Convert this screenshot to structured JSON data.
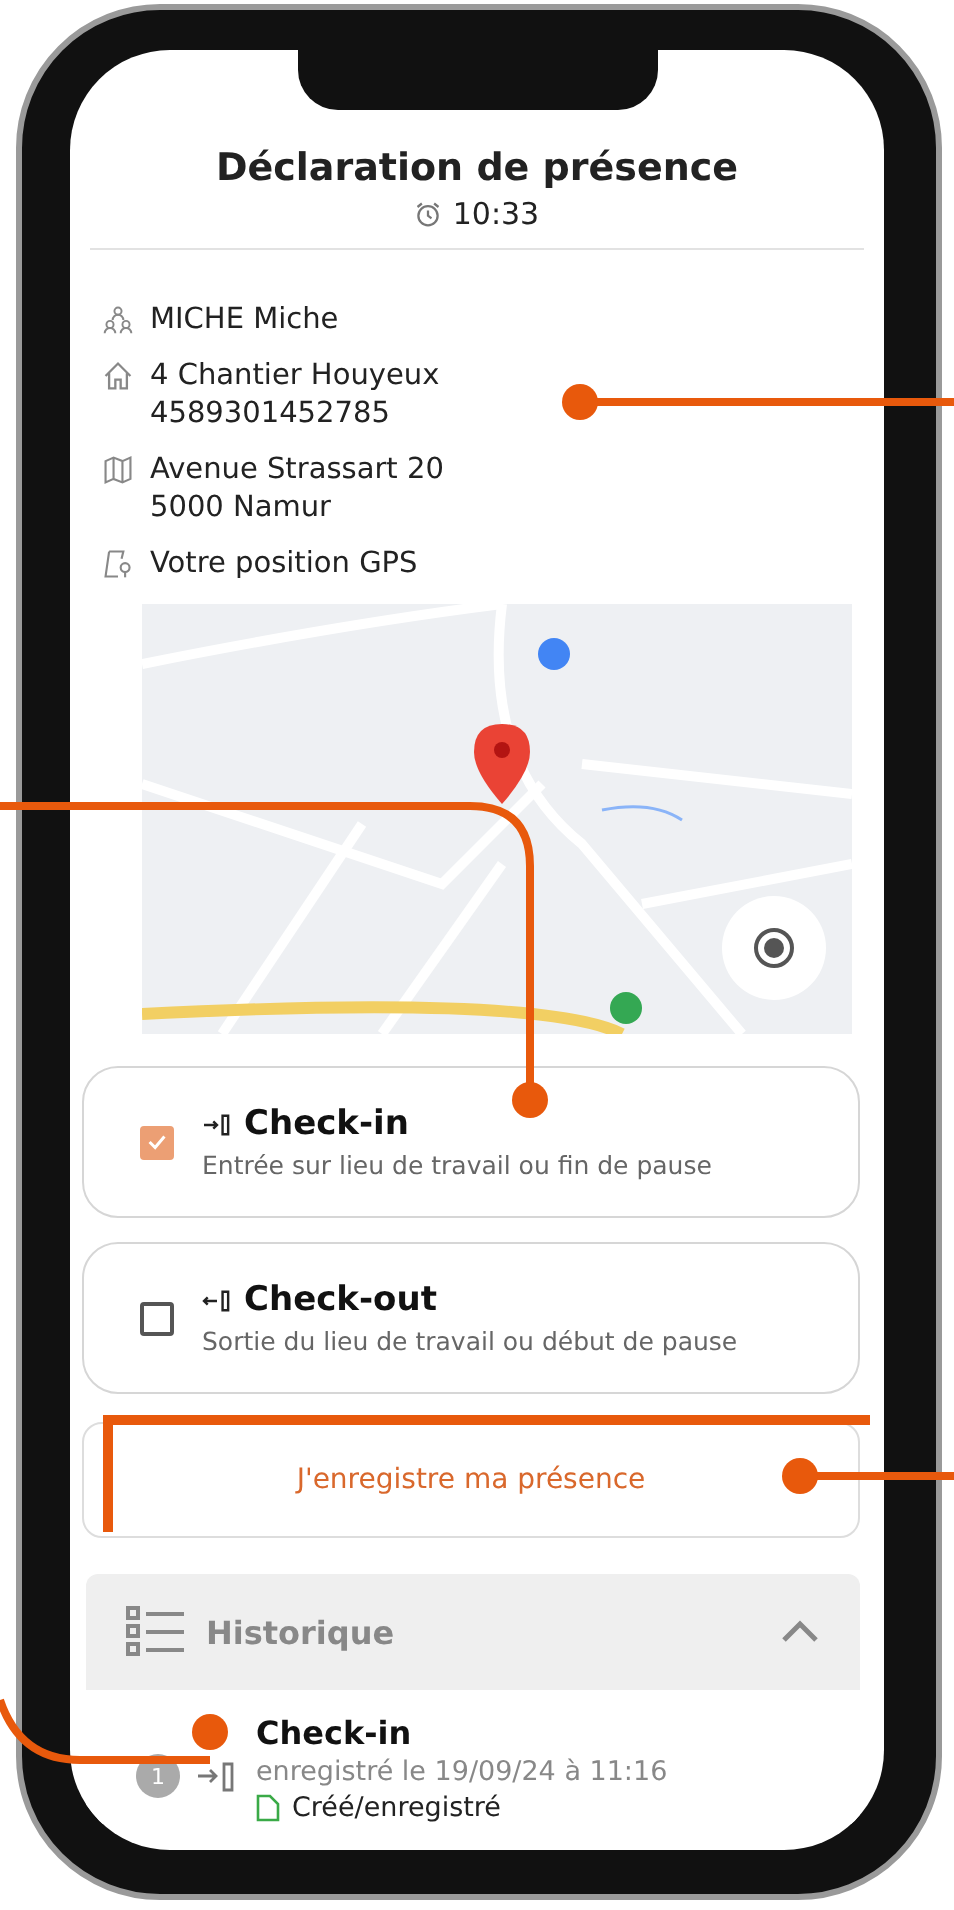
{
  "header": {
    "title": "Déclaration de présence",
    "time": "10:33"
  },
  "info": [
    {
      "kind": "person",
      "lines": [
        "MICHE Miche"
      ]
    },
    {
      "kind": "home",
      "lines": [
        "4 Chantier Houyeux",
        "4589301452785"
      ]
    },
    {
      "kind": "map",
      "lines": [
        "Avenue Strassart 20",
        "5000 Namur"
      ]
    },
    {
      "kind": "gps",
      "lines": [
        "Votre position GPS"
      ]
    }
  ],
  "options": [
    {
      "kind": "in",
      "title": "Check-in",
      "description": "Entrée sur lieu de travail ou fin de pause",
      "checked": true
    },
    {
      "kind": "out",
      "title": "Check-out",
      "description": "Sortie du lieu de travail ou début de pause",
      "checked": false
    }
  ],
  "register_button": "J'enregistre ma présence",
  "history": {
    "title": "Historique",
    "expanded": true,
    "entries": [
      {
        "kind": "in",
        "number": "1",
        "title": "Check-in",
        "subtitle": "enregistré le 19/09/24 à 11:16",
        "status": "Créé/enregistré"
      }
    ]
  }
}
